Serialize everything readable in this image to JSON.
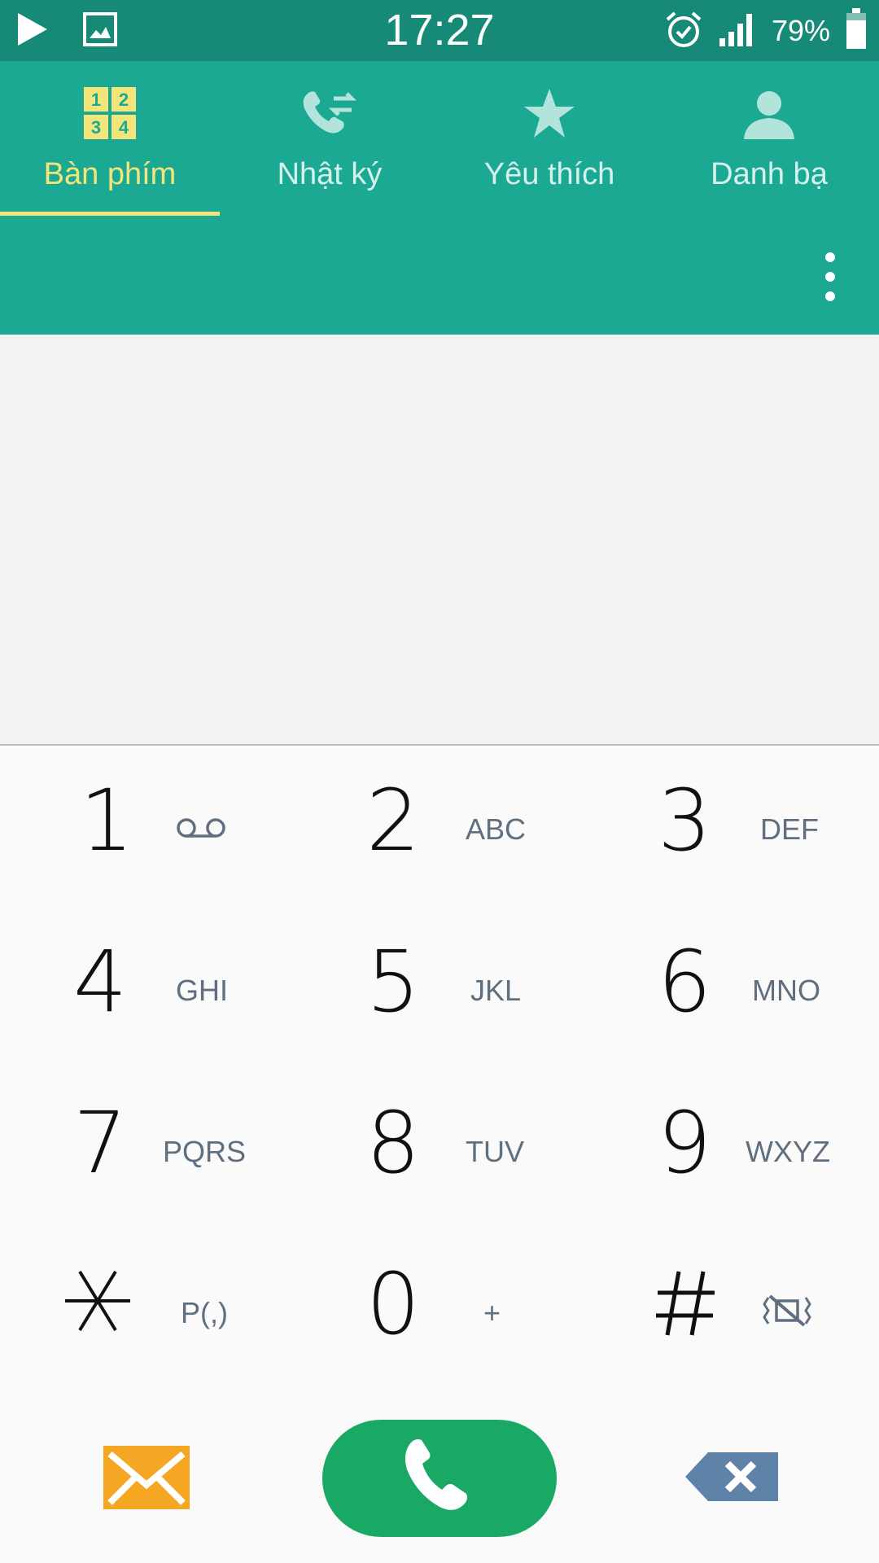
{
  "status_bar": {
    "time": "17:27",
    "battery_percent": "79%",
    "icons": [
      "play-icon",
      "image-icon",
      "alarm-icon",
      "signal-icon",
      "battery-icon"
    ]
  },
  "tabs": [
    {
      "label": "Bàn phím",
      "icon": "dialpad-grid-icon",
      "active": true
    },
    {
      "label": "Nhật ký",
      "icon": "call-log-icon",
      "active": false
    },
    {
      "label": "Yêu thích",
      "icon": "star-icon",
      "active": false
    },
    {
      "label": "Danh bạ",
      "icon": "contact-icon",
      "active": false
    }
  ],
  "dialpad_icon_digits": [
    "1",
    "2",
    "3",
    "4"
  ],
  "keypad": {
    "keys": [
      {
        "digit": "1",
        "letters": ""
      },
      {
        "digit": "2",
        "letters": "ABC"
      },
      {
        "digit": "3",
        "letters": "DEF"
      },
      {
        "digit": "4",
        "letters": "GHI"
      },
      {
        "digit": "5",
        "letters": "JKL"
      },
      {
        "digit": "6",
        "letters": "MNO"
      },
      {
        "digit": "7",
        "letters": "PQRS"
      },
      {
        "digit": "8",
        "letters": "TUV"
      },
      {
        "digit": "9",
        "letters": "WXYZ"
      },
      {
        "digit": "*",
        "letters": "P(,)"
      },
      {
        "digit": "0",
        "letters": "+"
      },
      {
        "digit": "#",
        "letters": ""
      }
    ]
  },
  "colors": {
    "status_bar": "#168a76",
    "header": "#1ba994",
    "active_tab": "#f3e57a",
    "call_button": "#1aa865",
    "message_button": "#f5a623",
    "delete_button": "#5f82a8"
  }
}
